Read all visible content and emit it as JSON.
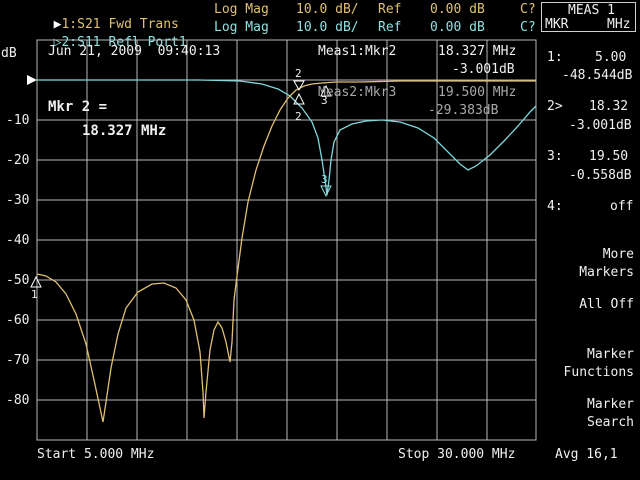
{
  "header": {
    "trace1": {
      "marker": "▶",
      "label": "1:S21 Fwd Trans",
      "format": "Log Mag",
      "scale": "10.0 dB/",
      "ref_label": "Ref",
      "ref": "0.00 dB",
      "flag": "C?"
    },
    "trace2": {
      "marker": "▷",
      "label": "2:S11 Refl Port1",
      "format": "Log Mag",
      "scale": "10.0 dB/",
      "ref_label": "Ref",
      "ref": "0.00 dB",
      "flag": "C?"
    }
  },
  "plot": {
    "unit": "dB",
    "timestamp": "Jun 21, 2009  09:40:13",
    "y_ticks": [
      "-10",
      "-20",
      "-30",
      "-40",
      "-50",
      "-60",
      "-70",
      "-80"
    ],
    "start": "Start 5.000 MHz",
    "stop": "Stop 30.000 MHz",
    "active_marker": {
      "line1": "Mkr 2 =",
      "line2": "18.327 MHz"
    },
    "meas1": {
      "label": "Meas1:Mkr2",
      "freq": "18.327 MHz",
      "value": "-3.001dB"
    },
    "meas2": {
      "label": "Meas2:Mkr3",
      "freq": "19.500 MHz",
      "value": "-29.383dB"
    },
    "marker_labels": [
      "1",
      "2",
      "2",
      "3",
      "3"
    ]
  },
  "menu": {
    "title_line1": "MEAS 1",
    "title_line2_left": "MKR",
    "title_line2_right": "MHz",
    "markers": [
      {
        "num": "1:",
        "freq": "5.00",
        "value": "-48.544dB"
      },
      {
        "num": "2>",
        "freq": "18.32",
        "value": "-3.001dB"
      },
      {
        "num": "3:",
        "freq": "19.50",
        "value": "-0.558dB"
      },
      {
        "num": "4:",
        "freq": "off",
        "value": ""
      }
    ],
    "more_markers_1": "More",
    "more_markers_2": "Markers",
    "all_off": "All Off",
    "marker_functions_1": "Marker",
    "marker_functions_2": "Functions",
    "marker_search_1": "Marker",
    "marker_search_2": "Search",
    "avg": "Avg 16,1"
  },
  "colors": {
    "trace1": "#e0c070",
    "trace2": "#7fd8dc",
    "grid": "#b8b8b8"
  }
}
